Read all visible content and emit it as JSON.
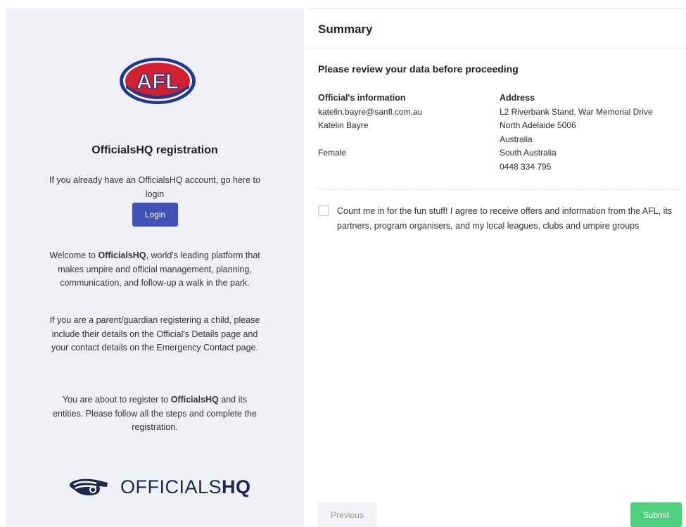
{
  "colors": {
    "left_panel_bg": "#eef0f6",
    "login_button": "#3f51b5",
    "submit_button": "#4fcf7f",
    "brand_navy": "#1b2a4a",
    "afl_red": "#d22030",
    "afl_blue": "#1d3a8f"
  },
  "left": {
    "logo_text": "AFL",
    "title": "OfficialsHQ registration",
    "login_prompt": "If you already have an OfficialsHQ account, go here to login",
    "login_button": "Login",
    "welcome_pre": "Welcome to ",
    "welcome_brand": "OfficialsHQ",
    "welcome_post": ", world's leading platform that makes umpire and official management, planning, communication, and follow-up a walk in the park.",
    "parent_note": "If you are a parent/guardian registering a child, please include their details on the Official's Details page and your contact details on the Emergency Contact page.",
    "register_pre": "You are about to register to ",
    "register_brand": "OfficialsHQ",
    "register_post": " and its entities. Please follow all the steps and complete the registration.",
    "brand_word_light": "OFFICIALS",
    "brand_word_bold": "HQ",
    "brand_icon": "whistle-icon"
  },
  "right": {
    "title": "Summary",
    "review_heading": "Please review your data before proceeding",
    "officials_info": {
      "heading": "Official's information",
      "email": "katelin.bayre@sanfl.com.au",
      "name": "Katelin Bayre",
      "gender": "Female"
    },
    "address": {
      "heading": "Address",
      "line1": "L2 Riverbank Stand, War Memorial Drive",
      "line2": "North Adelaide 5006",
      "country": "Australia",
      "state": "South Australia",
      "phone": "0448 334 795"
    },
    "consent_text": "Count me in for the fun stuff! I agree to receive offers and information from the AFL, its partners, program organisers, and my local leagues, clubs and umpire groups",
    "consent_checked": false,
    "previous_button": "Previous",
    "submit_button": "Submit"
  }
}
